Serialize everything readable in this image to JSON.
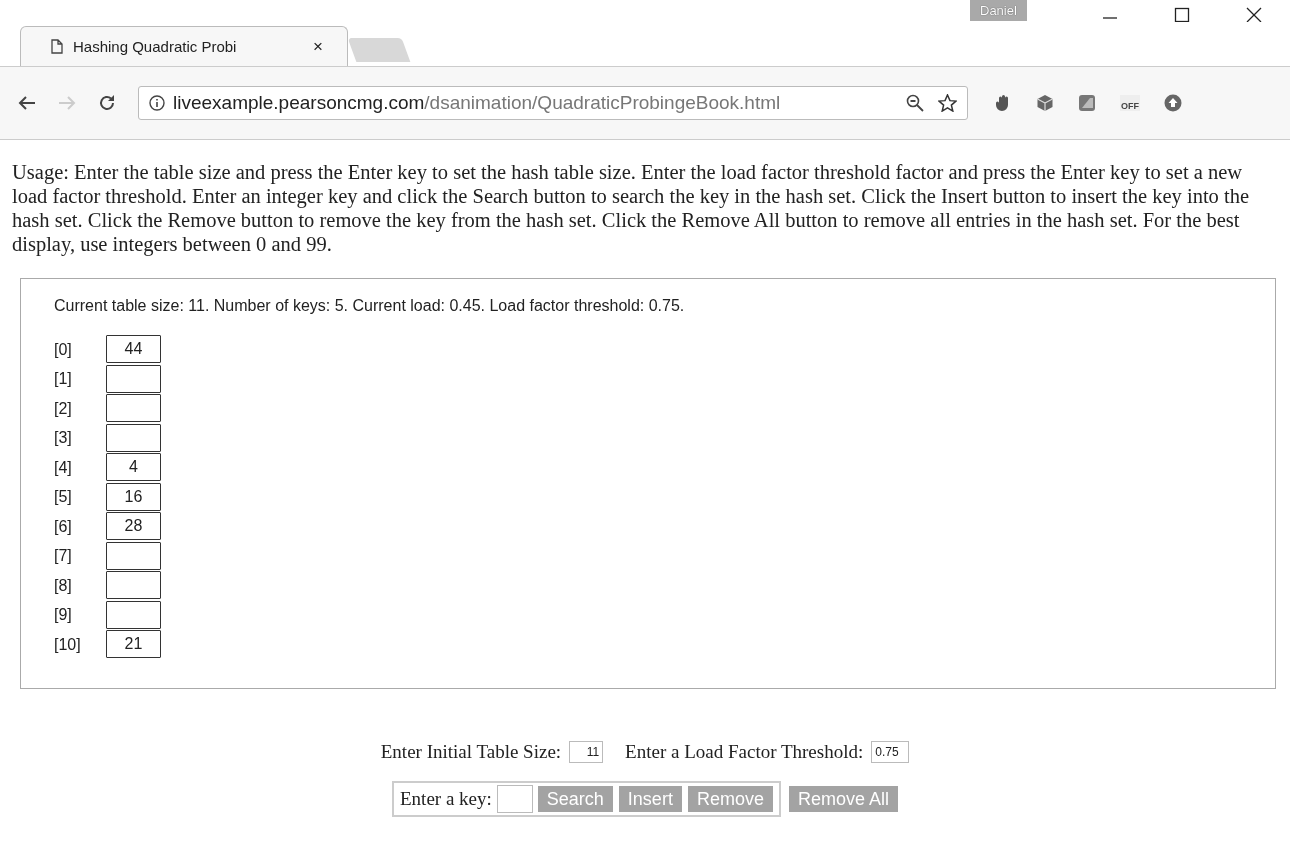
{
  "window": {
    "user": "Daniel"
  },
  "tabs": [
    {
      "title": "Hashing Quadratic Probi",
      "close": "×",
      "selected": true
    },
    {
      "selected": false
    }
  ],
  "address_bar": {
    "host": "liveexample.pearsoncmg.com",
    "path": "/dsanimation/QuadraticProbingeBook.html"
  },
  "extensions": [
    {
      "kind": "hand"
    },
    {
      "kind": "cube"
    },
    {
      "kind": "square"
    },
    {
      "kind": "off",
      "label": "OFF"
    },
    {
      "kind": "upload"
    }
  ],
  "usage": "Usage: Enter the table size and press the Enter key to set the hash table size. Enter the load factor threshold factor and press the Enter key to set a new load factor threshold. Enter an integer key and click the Search button to search the key in the hash set. Click the Insert button to insert the key into the hash set. Click the Remove button to remove the key from the hash set. Click the Remove All button to remove all entries in the hash set. For the best display, use integers between 0 and 99.",
  "status": "Current table size: 11. Number of keys: 5. Current load: 0.45. Load factor threshold: 0.75.",
  "slots": [
    {
      "index": "[0]",
      "value": "44"
    },
    {
      "index": "[1]"
    },
    {
      "index": "[2]"
    },
    {
      "index": "[3]"
    },
    {
      "index": "[4]",
      "value": "4"
    },
    {
      "index": "[5]",
      "value": "16"
    },
    {
      "index": "[6]",
      "value": "28"
    },
    {
      "index": "[7]"
    },
    {
      "index": "[8]"
    },
    {
      "index": "[9]"
    },
    {
      "index": "[10]",
      "value": "21"
    }
  ],
  "settings": {
    "size_label": "Enter Initial Table Size:",
    "size_value": "11",
    "threshold_label": "Enter a Load Factor Threshold:",
    "threshold_value": "0.75"
  },
  "key_panel": {
    "label": "Enter a key:",
    "buttons": [
      "Search",
      "Insert",
      "Remove"
    ],
    "remove_all": "Remove All"
  }
}
